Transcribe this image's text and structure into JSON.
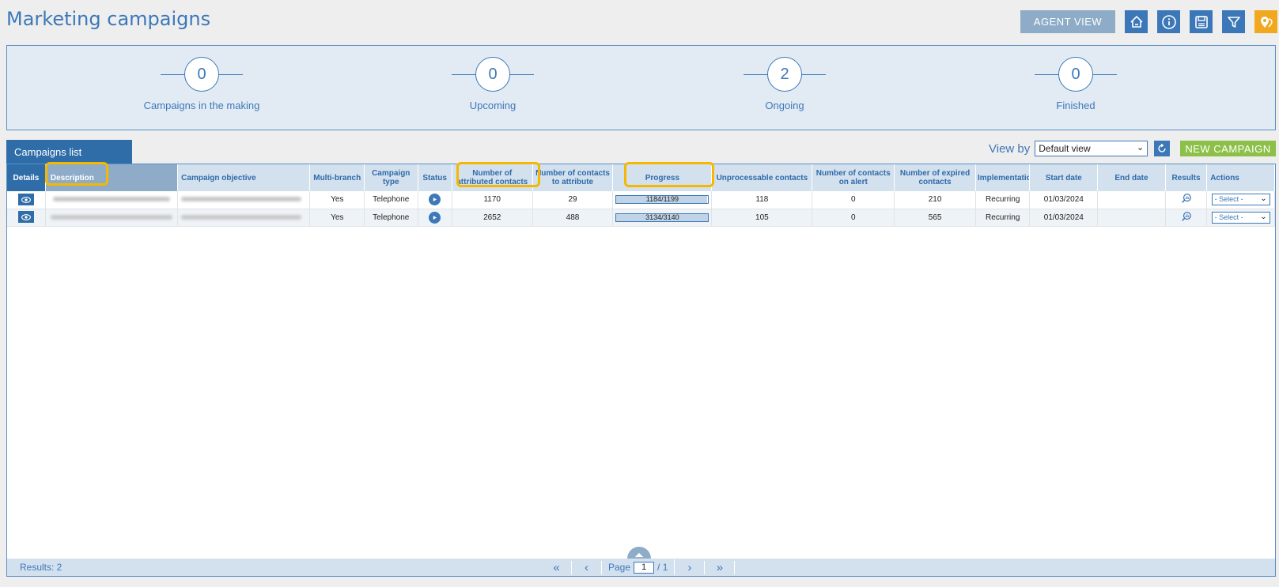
{
  "page_title": "Marketing campaigns",
  "toolbar": {
    "agent_view": "AGENT VIEW",
    "icons": [
      "home-icon",
      "info-icon",
      "save-icon",
      "filter-icon",
      "map-pin-icon"
    ]
  },
  "kpis": [
    {
      "value": "0",
      "label": "Campaigns in the making"
    },
    {
      "value": "0",
      "label": "Upcoming"
    },
    {
      "value": "2",
      "label": "Ongoing"
    },
    {
      "value": "0",
      "label": "Finished"
    }
  ],
  "tab_label": "Campaigns list",
  "view_by": {
    "label": "View by",
    "selected": "Default view"
  },
  "new_campaign": "NEW CAMPAIGN",
  "columns": {
    "details": "Details",
    "description": "Description",
    "objective": "Campaign objective",
    "multibranch": "Multi-branch",
    "type": "Campaign type",
    "status": "Status",
    "attributed": "Number of attributed contacts",
    "to_attribute": "Number of contacts to attribute",
    "progress": "Progress",
    "unprocessable": "Unprocessable contacts",
    "on_alert": "Number of contacts on alert",
    "expired": "Number of expired contacts",
    "implementation": "Implementation type",
    "start": "Start date",
    "end": "End date",
    "results": "Results",
    "actions": "Actions"
  },
  "rows": [
    {
      "multibranch": "Yes",
      "type": "Telephone",
      "attributed": "1170",
      "to_attribute": "29",
      "progress_text": "1184/1199",
      "progress_fraction": 0.987,
      "unprocessable": "118",
      "on_alert": "0",
      "expired": "210",
      "implementation": "Recurring",
      "start": "01/03/2024",
      "end": "",
      "action": "- Select -"
    },
    {
      "multibranch": "Yes",
      "type": "Telephone",
      "attributed": "2652",
      "to_attribute": "488",
      "progress_text": "3134/3140",
      "progress_fraction": 0.998,
      "unprocessable": "105",
      "on_alert": "0",
      "expired": "565",
      "implementation": "Recurring",
      "start": "01/03/2024",
      "end": "",
      "action": "- Select -"
    }
  ],
  "footer": {
    "results": "Results: 2",
    "page_label": "Page",
    "page_value": "1",
    "page_total": "/ 1"
  },
  "colors": {
    "primary": "#3c78b8",
    "accent_green": "#8cc048",
    "accent_orange": "#f0a91e",
    "highlight": "#f5b800"
  }
}
